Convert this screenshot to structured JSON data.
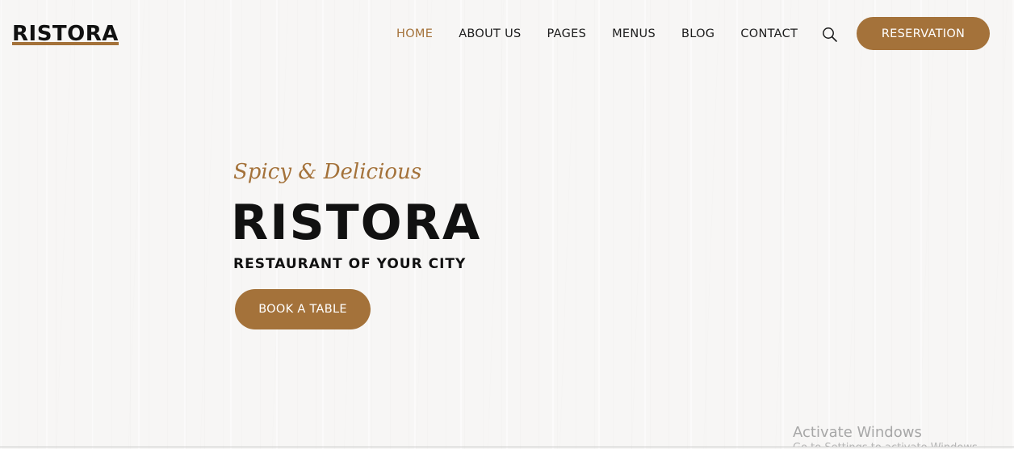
{
  "header": {
    "logo": "RISTORA",
    "nav": [
      {
        "label": "HOME",
        "active": true
      },
      {
        "label": "ABOUT US",
        "active": false
      },
      {
        "label": "PAGES",
        "active": false
      },
      {
        "label": "MENUS",
        "active": false
      },
      {
        "label": "BLOG",
        "active": false
      },
      {
        "label": "CONTACT",
        "active": false
      }
    ],
    "search_icon": "search-icon",
    "reservation_label": "RESERVATION"
  },
  "hero": {
    "tagline": "Spicy & Delicious",
    "title": "RISTORA",
    "subtitle": "RESTAURANT OF YOUR CITY",
    "cta_label": "BOOK A TABLE"
  },
  "watermark": {
    "title": "Activate Windows",
    "subtitle": "Go to Settings to activate Windows."
  },
  "colors": {
    "accent": "#a4723a",
    "text": "#111111",
    "background": "#f7f6f5"
  }
}
